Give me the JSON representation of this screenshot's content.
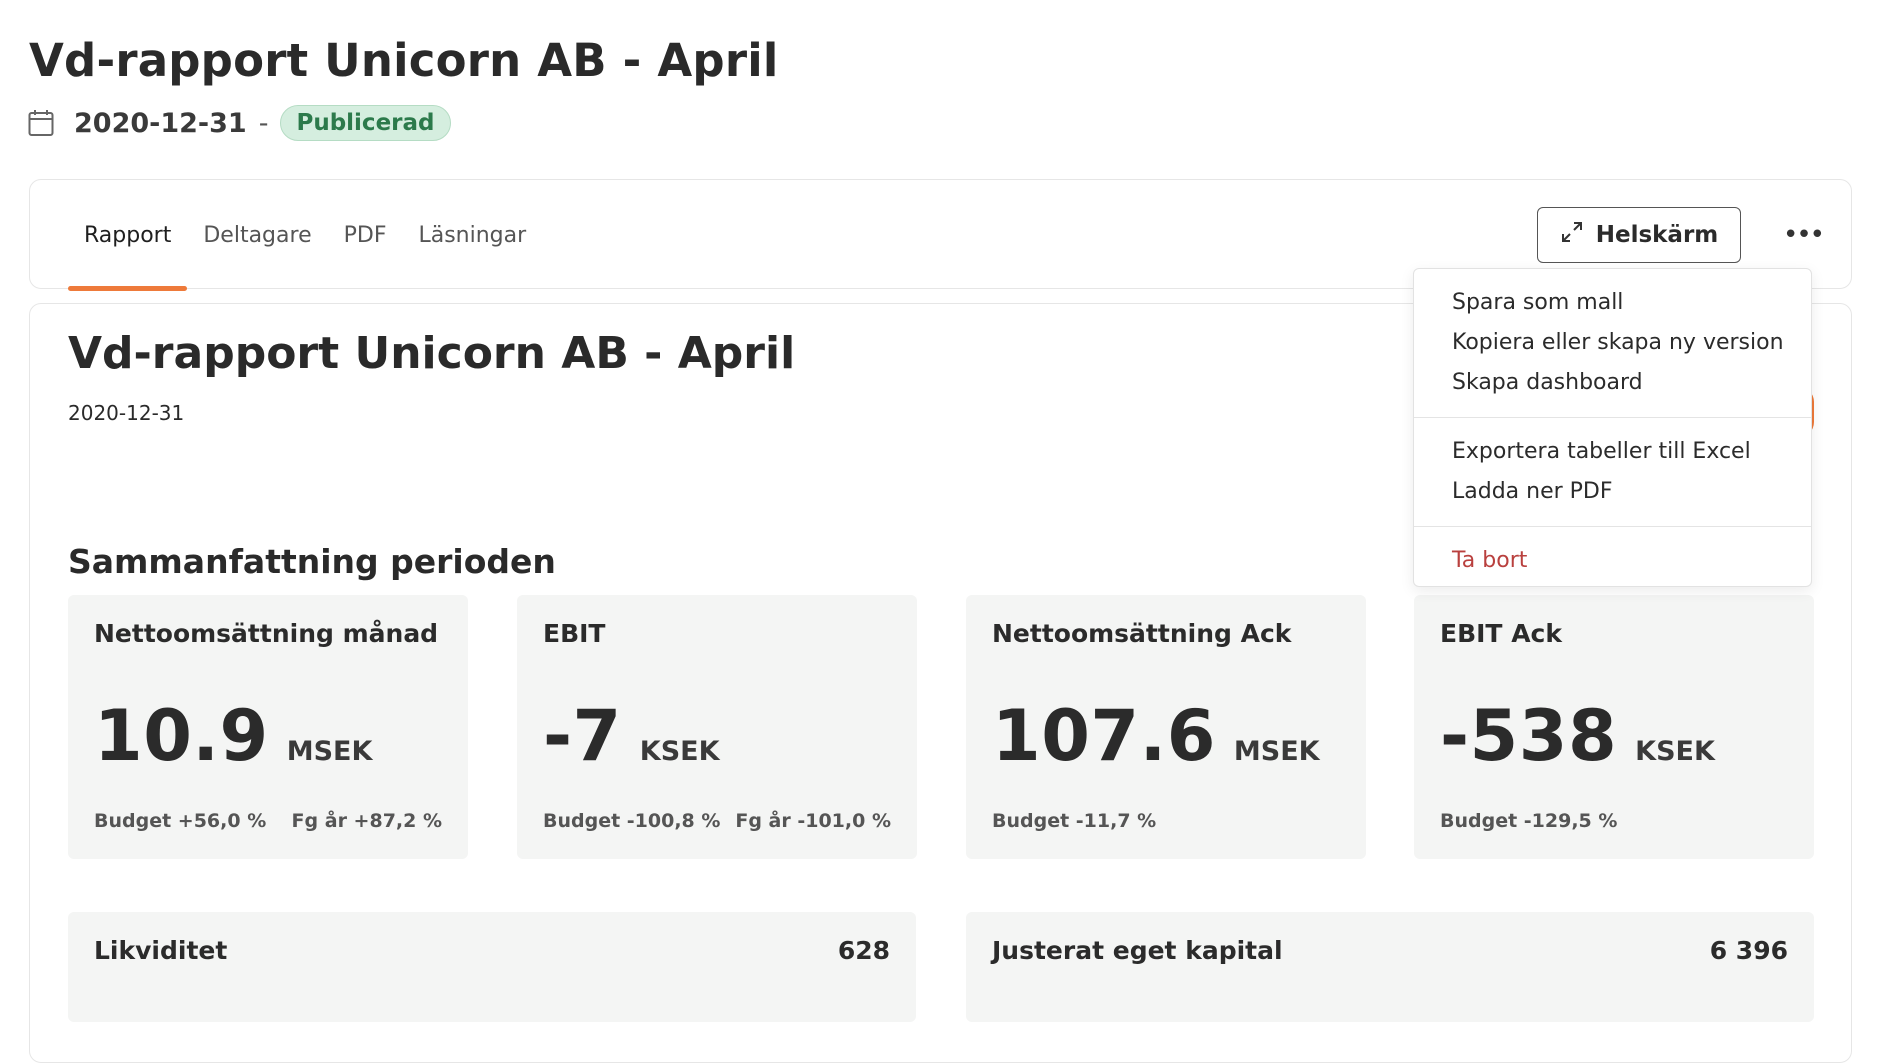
{
  "header": {
    "title": "Vd-rapport Unicorn AB - April",
    "date": "2020-12-31",
    "separator": "-",
    "status": "Publicerad"
  },
  "tabs": [
    {
      "label": "Rapport",
      "active": true
    },
    {
      "label": "Deltagare",
      "active": false
    },
    {
      "label": "PDF",
      "active": false
    },
    {
      "label": "Läsningar",
      "active": false
    }
  ],
  "toolbar": {
    "fullscreen_label": "Helskärm",
    "more_label": "•••"
  },
  "menu": {
    "groups": [
      [
        "Spara som mall",
        "Kopiera eller skapa ny version",
        "Skapa dashboard"
      ],
      [
        "Exportera tabeller till Excel",
        "Ladda ner PDF"
      ],
      [
        "Ta bort"
      ]
    ]
  },
  "report": {
    "title": "Vd-rapport Unicorn AB - April",
    "date": "2020-12-31",
    "section_title": "Sammanfattning perioden",
    "kpis": [
      {
        "label": "Nettoomsättning månad",
        "value": "10.9",
        "unit": "MSEK",
        "budget": "Budget +56,0 %",
        "prev_year": "Fg år +87,2 %"
      },
      {
        "label": "EBIT",
        "value": "-7",
        "unit": "KSEK",
        "budget": "Budget -100,8 %",
        "prev_year": "Fg år -101,0 %"
      },
      {
        "label": "Nettoomsättning Ack",
        "value": "107.6",
        "unit": "MSEK",
        "budget": "Budget -11,7 %",
        "prev_year": ""
      },
      {
        "label": "EBIT Ack",
        "value": "-538",
        "unit": "KSEK",
        "budget": "Budget -129,5 %",
        "prev_year": ""
      }
    ],
    "rows": [
      {
        "label": "Likviditet",
        "value": "628"
      },
      {
        "label": "Justerat eget kapital",
        "value": "6 396"
      }
    ]
  },
  "colors": {
    "accent": "#ee7a3a",
    "badge_bg": "#d5eedf",
    "badge_text": "#2c7a4b",
    "danger": "#b9403e",
    "tile_bg": "#f4f5f4"
  },
  "icons": {
    "calendar": "calendar-icon",
    "fullscreen": "expand-arrows-icon",
    "more": "more-horizontal-icon"
  }
}
